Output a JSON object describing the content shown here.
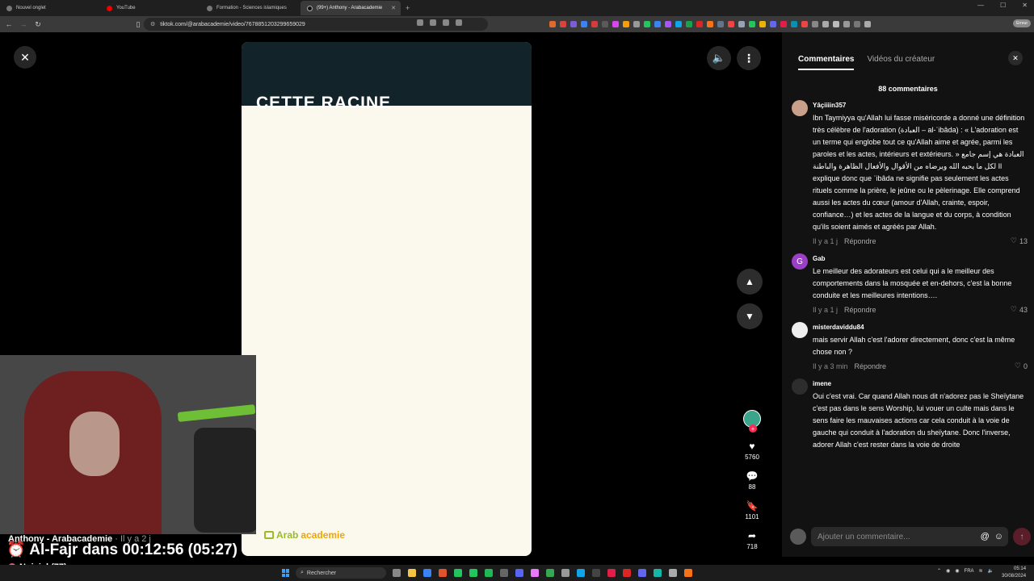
{
  "browser": {
    "tabs": [
      {
        "label": "Nouvel onglet",
        "active": false
      },
      {
        "label": "YouTube",
        "active": false
      },
      {
        "label": "Formation - Sciences islamiques",
        "active": false
      },
      {
        "label": "(99+) Anthony - Arabacademie",
        "active": true
      }
    ],
    "new_tab": "+",
    "url": "tiktok.com/@arabacademie/video/7678851203299659029",
    "error_label": "Erreur"
  },
  "video": {
    "overlay_title": "CETTE RACINE",
    "logo_text_1": "Arab",
    "logo_text_2": "academie"
  },
  "actions": {
    "likes": "5760",
    "comments": "88",
    "saves": "1101",
    "shares": "718"
  },
  "stream_overlay": {
    "name": "Anthony - Arabacademie",
    "ago": "· Il y a 2 j",
    "prayer": "Al-Fajr dans 00:12:56 (05:27)",
    "noise": "Noisiel (77)"
  },
  "panel": {
    "tab_comments": "Commentaires",
    "tab_videos": "Vidéos du créateur",
    "count": "88 commentaires",
    "comments": [
      {
        "user": "Yâçiiiin357",
        "text": "Ibn Taymiyya qu'Allah lui fasse miséricorde a donné une définition très célèbre de l'adoration (العبادة – al-ʿibâda) : « L'adoration est un terme qui englobe tout ce qu'Allah aime et agrée, parmi les paroles et les actes, intérieurs et extérieurs. » العبادة هي إسم جامع لكل ما يحبه الله ويرضاه من الأقوال والأفعال الظاهرة والباطنة Il explique donc que ʿibâda ne signifie pas seulement les actes rituels comme la prière, le jeûne ou le pèlerinage. Elle comprend aussi les actes du cœur (amour d'Allah, crainte, espoir, confiance…) et les actes de la langue et du corps, à condition qu'ils soient aimés et agréés par Allah.",
        "time": "Il y a 1 j",
        "reply": "Répondre",
        "likes": "13",
        "avatar_color": "#c9a08a",
        "avatar_letter": ""
      },
      {
        "user": "Gab",
        "text": "Le meilleur des adorateurs est celui qui a le meilleur des comportements dans la mosquée et en-dehors, c'est la bonne conduite et les meilleures intentions….",
        "time": "Il y a 1 j",
        "reply": "Répondre",
        "likes": "43",
        "avatar_color": "#9c3fc7",
        "avatar_letter": "G"
      },
      {
        "user": "misterdaviddu84",
        "text": "mais servir Allah c'est l'adorer directement, donc c'est la même chose non ?",
        "time": "Il y a 3 min",
        "reply": "Répondre",
        "likes": "0",
        "avatar_color": "#eeeeee",
        "avatar_letter": ""
      },
      {
        "user": "imene",
        "text": "Oui c'est vrai. Car quand Allah nous dit n'adorez pas le Sheïytane c'est pas dans le sens Worship, lui vouer un culte mais dans le sens faire les mauvaises actions car cela conduit à la voie de gauche qui conduit à l'adoration du sheïytane. Donc l'inverse, adorer Allah c'est rester dans la voie de droite",
        "time": "",
        "reply": "",
        "likes": "",
        "avatar_color": "#2d2d2d",
        "avatar_letter": ""
      }
    ],
    "input_placeholder": "Ajouter un commentaire..."
  },
  "taskbar": {
    "search": "Rechercher",
    "lang": "FRA",
    "time": "05:14",
    "date": "30/08/2024"
  }
}
